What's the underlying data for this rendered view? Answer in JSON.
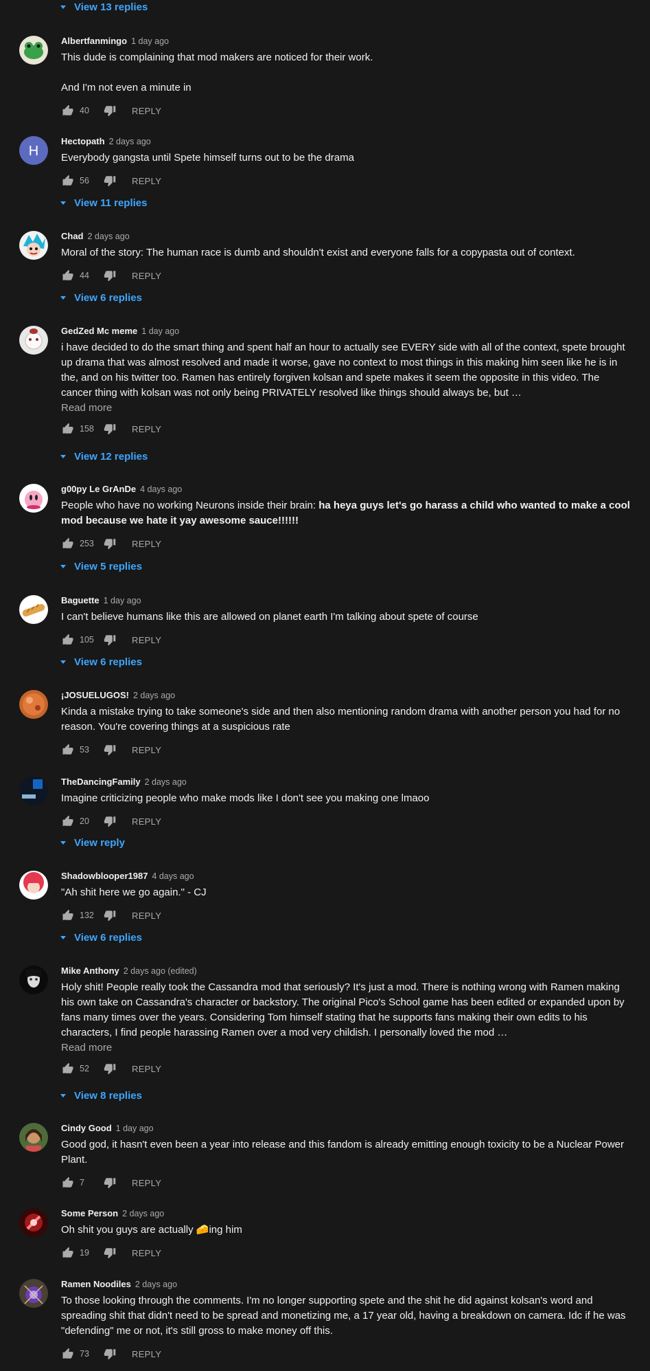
{
  "top_view_replies": "View 13 replies",
  "reply_label": "REPLY",
  "comments": [
    {
      "author": "Albertfanmingo",
      "time": "1 day ago",
      "text": "This dude is complaining that mod makers are noticed for their work.\n\nAnd I'm not even a minute in",
      "likes": "40",
      "replies": "",
      "avatar": "green-frog-avatar"
    },
    {
      "author": "Hectopath",
      "time": "2 days ago",
      "text": "Everybody gangsta until Spete himself turns out to be the drama",
      "likes": "56",
      "replies": "View 11 replies",
      "avatar": "letter-h-avatar",
      "avatar_letter": "H"
    },
    {
      "author": "Chad",
      "time": "2 days ago",
      "text": "Moral of the story: The human race is dumb and shouldn't exist and everyone falls for a copypasta out of context.",
      "likes": "44",
      "replies": "View 6 replies",
      "avatar": "cartoon-character-avatar"
    },
    {
      "author": "GedZed Mc meme",
      "time": "1 day ago",
      "text": "i have decided to do the smart thing and spent half an hour to actually see EVERY side with all of the context, spete brought up drama that was almost resolved and made it worse, gave no context to most things in this making him seen like he is in the, and on his twitter too. Ramen has entirely forgiven kolsan and spete makes it seem the opposite in this video. The cancer thing with kolsan was not only being PRIVATELY resolved like things should always be, but …",
      "read_more": "Read more",
      "likes": "158",
      "replies": "View 12 replies",
      "avatar": "white-creature-avatar"
    },
    {
      "author": "g00py Le GrAnDe",
      "time": "4 days ago",
      "text_plain": "People who have no working Neurons inside their brain: ",
      "text_bold": "ha heya guys let's go harass a child who wanted to make a cool mod because we hate it yay awesome sauce!!!!!!",
      "likes": "253",
      "replies": "View 5 replies",
      "avatar": "pink-kirby-avatar"
    },
    {
      "author": "Baguette",
      "time": "1 day ago",
      "text": "I can't believe humans like this are allowed on planet earth I'm talking about spete of course",
      "likes": "105",
      "replies": "View 6 replies",
      "avatar": "baguette-avatar"
    },
    {
      "author": "¡JOSUELUGOS!",
      "time": "2 days ago",
      "text": "Kinda a mistake trying to take someone's side and then also mentioning random drama with another person you had for no reason. You're covering things at a suspicious rate",
      "likes": "53",
      "replies": "",
      "avatar": "orange-sphere-avatar"
    },
    {
      "author": "TheDancingFamily",
      "time": "2 days ago",
      "text": "Imagine criticizing people who make mods like I don't see you making one lmaoo",
      "likes": "20",
      "replies": "View reply",
      "avatar": "dark-blue-avatar"
    },
    {
      "author": "Shadowblooper1987",
      "time": "4 days ago",
      "text": "\"Ah shit here we go again.\" - CJ",
      "likes": "132",
      "replies": "View 6 replies",
      "avatar": "red-hair-anime-avatar"
    },
    {
      "author": "Mike Anthony",
      "time": "2 days ago (edited)",
      "text": "Holy shit! People really took the Cassandra mod that seriously? It's just a mod. There is nothing wrong with Ramen making his own take on Cassandra's character or backstory. The original Pico's School game has been edited or expanded upon by fans many times over the years. Considering Tom himself stating that he supports fans making their own edits to his characters, I find people harassing Ramen over a mod very childish. I personally loved the mod …",
      "read_more": "Read more",
      "likes": "52",
      "replies": "View 8 replies",
      "avatar": "dark-figure-avatar"
    },
    {
      "author": "Cindy Good",
      "time": "1 day ago",
      "text": "Good god, it hasn't even been a year into release and this fandom is already emitting enough toxicity to be a Nuclear Power Plant.",
      "likes": "7",
      "replies": "",
      "avatar": "person-photo-avatar"
    },
    {
      "author": "Some Person",
      "time": "2 days ago",
      "text_plain": "Oh shit you guys are actually ",
      "emoji": "🧀",
      "text_after": "ing him",
      "likes": "19",
      "replies": "",
      "avatar": "red-swirl-avatar"
    },
    {
      "author": "Ramen Noodiles",
      "time": "2 days ago",
      "text": "To those looking through the comments. I'm no longer supporting spete and the shit he did against kolsan's word and spreading shit that didn't need to be spread and monetizing me, a 17 year old, having a breakdown on camera. Idc if he was \"defending\" me or not, it's still gross to make money off this.",
      "likes": "73",
      "replies": "",
      "avatar": "purple-glow-avatar"
    }
  ],
  "colors": {
    "background": "#181818",
    "text": "#f1f1f1",
    "secondary": "#aaaaaa",
    "link": "#3ea6ff"
  }
}
